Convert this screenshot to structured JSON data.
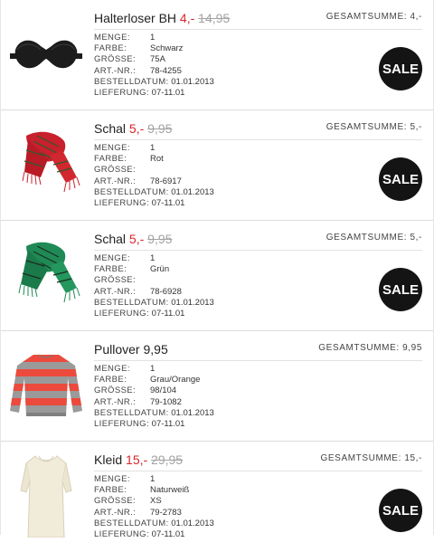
{
  "labels": {
    "total": "GESAMTSUMME:",
    "menge": "MENGE:",
    "farbe": "FARBE:",
    "groesse": "GRÖSSE:",
    "artnr": "ART.-NR.:",
    "bestelldatum": "BESTELLDATUM:",
    "lieferung": "LIEFERUNG:"
  },
  "sale_badge": "SALE",
  "items": [
    {
      "name": "Halterloser BH",
      "price": "4,-",
      "old_price": "14,95",
      "total": "4,-",
      "menge": "1",
      "farbe": "Schwarz",
      "groesse": "75A",
      "artnr": "78-4255",
      "bestelldatum": "01.01.2013",
      "lieferung": "07-11.01",
      "icon": "bra-icon"
    },
    {
      "name": "Schal",
      "price": "5,-",
      "old_price": "9,95",
      "total": "5,-",
      "menge": "1",
      "farbe": "Rot",
      "groesse": "",
      "artnr": "78-6917",
      "bestelldatum": "01.01.2013",
      "lieferung": "07-11.01",
      "icon": "scarf-icon"
    },
    {
      "name": "Schal",
      "price": "5,-",
      "old_price": "9,95",
      "total": "5,-",
      "menge": "1",
      "farbe": "Grün",
      "groesse": "",
      "artnr": "78-6928",
      "bestelldatum": "01.01.2013",
      "lieferung": "07-11.01",
      "icon": "scarf-icon"
    },
    {
      "name": "Pullover",
      "price": "9,95",
      "old_price": "",
      "total": "9,95",
      "menge": "1",
      "farbe": "Grau/Orange",
      "groesse": "98/104",
      "artnr": "79-1082",
      "bestelldatum": "01.01.2013",
      "lieferung": "07-11.01",
      "icon": "sweater-icon"
    },
    {
      "name": "Kleid",
      "price": "15,-",
      "old_price": "29,95",
      "total": "15,-",
      "menge": "1",
      "farbe": "Naturweiß",
      "groesse": "XS",
      "artnr": "79-2783",
      "bestelldatum": "01.01.2013",
      "lieferung": "07-11.01",
      "icon": "dress-icon"
    }
  ],
  "colors": {
    "sale_price": "#d6262a",
    "old_price": "#a3a3a3",
    "badge": "#141414",
    "bra": "#1c1c1c",
    "scarf_red": "#c8202c",
    "scarf_green": "#1f8a55",
    "sweater_gray": "#9a9a9a",
    "sweater_orange": "#ec4a3c",
    "dress": "#f1ebd9"
  }
}
